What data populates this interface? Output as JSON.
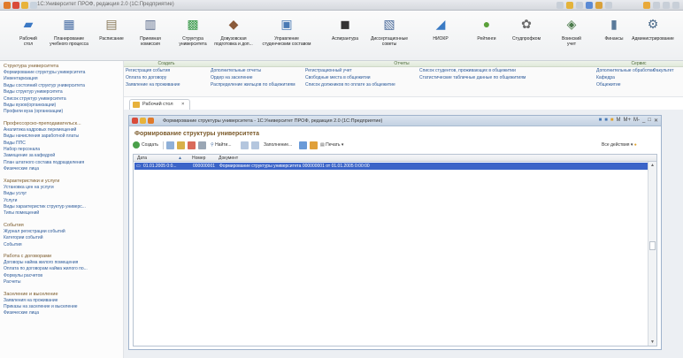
{
  "window": {
    "title": "1С:Университет ПРОФ, редакция 2.0 (1С:Предприятие)"
  },
  "sections": [
    {
      "label": "Рабочий\nстол",
      "icon": "desk-icon",
      "color": "#3b78c4"
    },
    {
      "label": "Планирование\nучебного процесса",
      "icon": "planning-icon",
      "color": "#4a6fa5"
    },
    {
      "label": "Расписание",
      "icon": "schedule-icon",
      "color": "#8a7a5a"
    },
    {
      "label": "Приемная\nкомиссия",
      "icon": "admission-icon",
      "color": "#5a6a8a"
    },
    {
      "label": "Структура\nуниверситета",
      "icon": "structure-icon",
      "color": "#3a9a4a"
    },
    {
      "label": "Довузовская\nподготовка и доп...",
      "icon": "preuniversity-icon",
      "color": "#8a5a3a"
    },
    {
      "label": "Управление\nстуденческим составом",
      "icon": "students-icon",
      "color": "#4a7ab4"
    },
    {
      "label": "Аспирантура",
      "icon": "graduate-icon",
      "color": "#333333"
    },
    {
      "label": "Диссертационные\nсоветы",
      "icon": "dissertation-icon",
      "color": "#4a6a9a"
    },
    {
      "label": "НИОКР",
      "icon": "research-icon",
      "color": "#3a7ac4"
    },
    {
      "label": "Рейтинги",
      "icon": "ratings-icon",
      "color": "#5aa03a"
    },
    {
      "label": "Студпрофком",
      "icon": "union-icon",
      "color": "#6a6a6a"
    },
    {
      "label": "Воинский\nучет",
      "icon": "military-icon",
      "color": "#4a7a4a"
    },
    {
      "label": "Финансы",
      "icon": "finance-icon",
      "color": "#5a7a9a"
    },
    {
      "label": "Администрирование",
      "icon": "admin-icon",
      "color": "#4a6a8a"
    }
  ],
  "nav": [
    {
      "title": "Структура университета",
      "items": [
        "Формирование структуры университета",
        "Инвентаризация",
        "Виды состояний структур университета",
        "Виды структур университета",
        "Список структур университета",
        "Виды вузов(организации)",
        "Профили вуза (организации)"
      ]
    },
    {
      "title": "Профессорско-преподавательск...",
      "items": [
        "Аналитика кадровых перемещений",
        "Виды начисления заработной платы",
        "Виды ППС",
        "Набор персонала",
        "Замещение за кафедрой",
        "План штатного состава подразделения",
        "Физические лица"
      ]
    },
    {
      "title": "Характеристики и услуги",
      "items": [
        "Установка цен на услуги",
        "Виды услуг",
        "Услуги",
        "Виды характеристик структур универс...",
        "Типы помещений"
      ]
    },
    {
      "title": "События",
      "items": [
        "Журнал регистрации событий",
        "Категории событий",
        "События"
      ]
    },
    {
      "title": "Работа с договорами",
      "items": [
        "Договоры найма жилого помещения",
        "Оплата по договорам найма жилого по...",
        "Формулы расчетов",
        "Расчеты"
      ]
    },
    {
      "title": "Заселение и выселение",
      "items": [
        "Заявления на проживание",
        "Приказы на заселение и выселение",
        "Физические лица"
      ]
    }
  ],
  "actions": {
    "create": {
      "header": "Создать",
      "links": [
        "Регистрация события",
        "Оплата по договору",
        "Заявление на проживание"
      ]
    },
    "reports": {
      "header": "Отчеты",
      "col1": [
        "Дополнительные отчеты",
        "Ордер на заселение",
        "Распределение жильцов по общежитиям"
      ],
      "col2": [
        "Регистрационный учет",
        "Свободные места в общежитии",
        "Список должников по оплате за общежитие"
      ],
      "col3": [
        "Список студентов, проживающих в общежитии",
        "Статистические табличные данные по общежитиям"
      ]
    },
    "service": {
      "header": "Сервис",
      "col1": [
        "Дополнительные обработки",
        "Кафедра",
        "Общежитие"
      ],
      "col2": [
        "Факультет"
      ]
    }
  },
  "tab": {
    "label": "Рабочий стол"
  },
  "document": {
    "window_title": "Формирование структуры университета - 1С:Университет ПРОФ, редакция 2.0 (1С:Предприятие)",
    "heading": "Формирование структуры университета",
    "toolbar": {
      "create": "Создать",
      "find": "Найти...",
      "fill": "Заполнение...",
      "print": "Печать ▾",
      "all_actions": "Все действия ▾"
    },
    "columns": [
      "Дата",
      "Номер",
      "Документ"
    ],
    "rows": [
      {
        "date": "01.01.2005 0:0...",
        "number": "000000001",
        "document": "Формирование структуры университета 000000001 от 01.01.2005 0:00:00"
      }
    ]
  }
}
